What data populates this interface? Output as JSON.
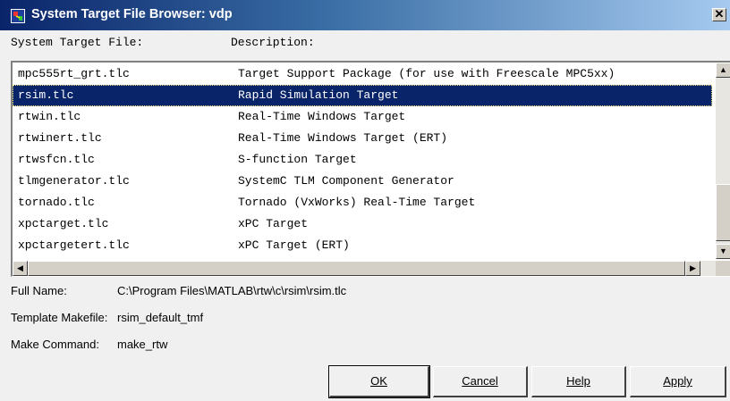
{
  "window": {
    "title": "System Target File Browser: vdp",
    "close_glyph": "✕"
  },
  "columns": {
    "file_header": "System Target File:",
    "desc_header": "Description:"
  },
  "targets": [
    {
      "file": "mpc555rt_grt.tlc",
      "description": "Target Support Package (for use with Freescale MPC5xx)"
    },
    {
      "file": "rsim.tlc",
      "description": "Rapid Simulation Target"
    },
    {
      "file": "rtwin.tlc",
      "description": "Real-Time Windows Target"
    },
    {
      "file": "rtwinert.tlc",
      "description": "Real-Time Windows Target (ERT)"
    },
    {
      "file": "rtwsfcn.tlc",
      "description": "S-function Target"
    },
    {
      "file": "tlmgenerator.tlc",
      "description": "SystemC TLM Component Generator"
    },
    {
      "file": "tornado.tlc",
      "description": "Tornado (VxWorks) Real-Time Target"
    },
    {
      "file": "xpctarget.tlc",
      "description": "xPC Target"
    },
    {
      "file": "xpctargetert.tlc",
      "description": "xPC Target (ERT)"
    }
  ],
  "selected_index": 1,
  "scrollbar": {
    "up_glyph": "▲",
    "down_glyph": "▼",
    "left_glyph": "◀",
    "right_glyph": "▶"
  },
  "info": {
    "full_name_label": "Full Name:",
    "full_name_value": "C:\\Program Files\\MATLAB\\rtw\\c\\rsim\\rsim.tlc",
    "template_label": "Template Makefile:",
    "template_value": "rsim_default_tmf",
    "make_label": "Make Command:",
    "make_value": "make_rtw"
  },
  "buttons": {
    "ok": "OK",
    "cancel": "Cancel",
    "help": "Help",
    "apply": "Apply"
  }
}
